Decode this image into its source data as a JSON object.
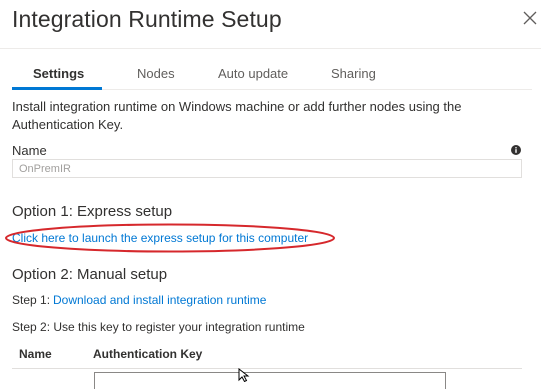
{
  "dialog": {
    "title": "Integration Runtime Setup",
    "close_icon": "close-icon"
  },
  "tabs": [
    {
      "label": "Settings",
      "active": true
    },
    {
      "label": "Nodes",
      "active": false
    },
    {
      "label": "Auto update",
      "active": false
    },
    {
      "label": "Sharing",
      "active": false
    }
  ],
  "settings": {
    "description": "Install integration runtime on Windows machine or add further nodes using the Authentication Key.",
    "name_label": "Name",
    "name_value": "OnPremIR",
    "info_icon": "info-icon",
    "option1_title": "Option 1: Express setup",
    "express_link": "Click here to launch the express setup for this computer",
    "option2_title": "Option 2: Manual setup",
    "step1_prefix": "Step 1:",
    "step1_link": "Download and install integration runtime",
    "step2_text": "Step 2: Use this key to register your integration runtime",
    "table": {
      "columns": [
        "Name",
        "Authentication Key"
      ]
    }
  },
  "colors": {
    "accent": "#0078d4",
    "annotation": "#d6282c",
    "text": "#323130",
    "muted": "#605e5c"
  }
}
